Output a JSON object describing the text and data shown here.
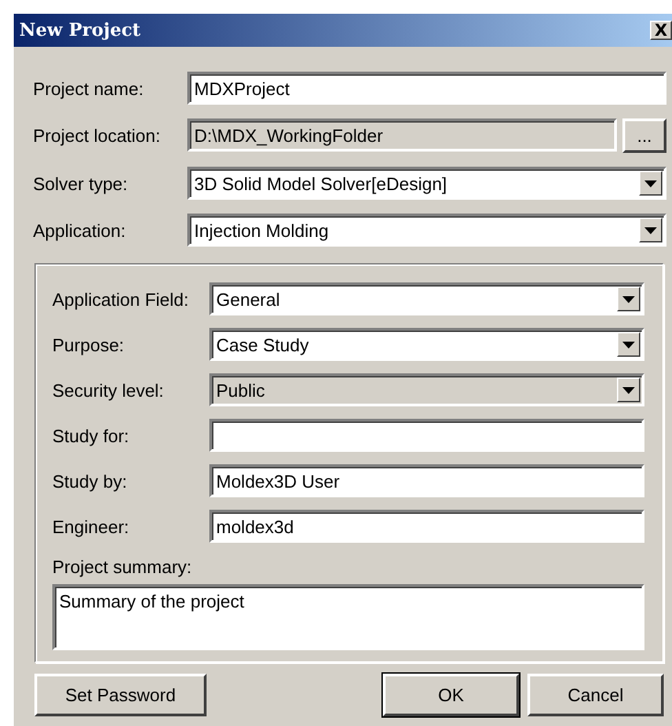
{
  "window": {
    "title": "New Project",
    "close": "X"
  },
  "fields": [
    {
      "label": "Project name:",
      "kind": "text",
      "value": "MDXProject",
      "disabled": false
    },
    {
      "label": "Project location:",
      "kind": "path",
      "value": "D:\\MDX_WorkingFolder",
      "disabled": true,
      "browse": "..."
    },
    {
      "label": "Solver type:",
      "kind": "combo",
      "value": "3D Solid Model Solver[eDesign]",
      "disabled": false
    },
    {
      "label": "Application:",
      "kind": "combo",
      "value": "Injection Molding",
      "disabled": false
    }
  ],
  "details": {
    "fields": [
      {
        "label": "Application Field:",
        "kind": "combo",
        "value": "General",
        "disabled": false
      },
      {
        "label": "Purpose:",
        "kind": "combo",
        "value": "Case Study",
        "disabled": false
      },
      {
        "label": "Security level:",
        "kind": "combo",
        "value": "Public",
        "disabled": true
      },
      {
        "label": "Study for:",
        "kind": "text",
        "disabled": false
      },
      {
        "label": "Study by:",
        "kind": "text",
        "value": "Moldex3D User",
        "disabled": false
      },
      {
        "label": "Engineer:",
        "kind": "text",
        "value": "moldex3d",
        "disabled": false
      }
    ],
    "summary": {
      "label": "Project summary:",
      "value": "Summary of the project"
    }
  },
  "buttons": [
    {
      "label": "Set Password",
      "kind": "left",
      "default": false
    },
    {
      "label": "OK",
      "kind": "right",
      "default": true
    },
    {
      "label": "Cancel",
      "kind": "right",
      "default": false
    }
  ]
}
